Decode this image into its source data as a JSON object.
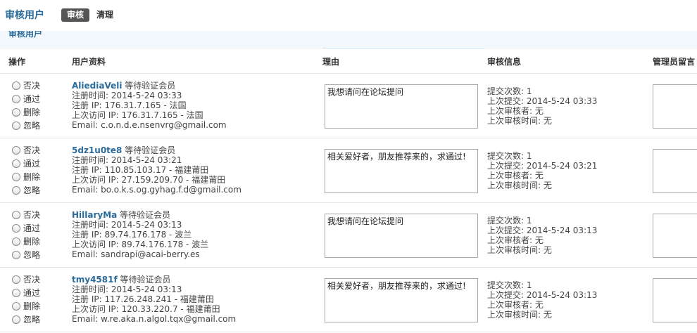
{
  "header": {
    "title": "审核用户",
    "tabs": [
      {
        "label": "审核",
        "active": true
      },
      {
        "label": "清理",
        "active": false
      }
    ]
  },
  "section": {
    "title": "审核用户"
  },
  "columns": {
    "action": "操作",
    "profile": "用户资料",
    "reason": "理由",
    "audit": "审核信息",
    "admin_note": "管理员留言"
  },
  "radio_labels": [
    "否决",
    "通过",
    "删除",
    "忽略"
  ],
  "users": [
    {
      "username": "AliediaVeli",
      "group": "等待验证会员",
      "reg_time": "注册时间: 2014-5-24 03:33",
      "reg_ip": "注册 IP: 176.31.7.165 - 法国",
      "last_ip": "上次访问 IP: 176.31.7.165 - 法国",
      "email": "Email: c.o.n.d.e.nsenvrg@gmail.com",
      "reason": "我想请问在论坛提问",
      "submit_count": "提交次数: 1",
      "last_submit": "上次提交: 2014-5-24 03:33",
      "last_reviewer": "上次审核者: 无",
      "last_review_time": "上次审核时间: 无"
    },
    {
      "username": "5dz1u0te8",
      "group": "等待验证会员",
      "reg_time": "注册时间: 2014-5-24 03:21",
      "reg_ip": "注册 IP: 110.85.103.17 - 福建莆田",
      "last_ip": "上次访问 IP: 27.159.209.70 - 福建莆田",
      "email": "Email: bo.o.k.s.og.gyhag.f.d@gmail.com",
      "reason": "相关爱好者，朋友推荐来的，求通过!",
      "submit_count": "提交次数: 1",
      "last_submit": "上次提交: 2014-5-24 03:21",
      "last_reviewer": "上次审核者: 无",
      "last_review_time": "上次审核时间: 无"
    },
    {
      "username": "HillaryMa",
      "group": "等待验证会员",
      "reg_time": "注册时间: 2014-5-24 03:13",
      "reg_ip": "注册 IP: 89.74.176.178 - 波兰",
      "last_ip": "上次访问 IP: 89.74.176.178 - 波兰",
      "email": "Email: sandrapi@acai-berry.es",
      "reason": "我想请问在论坛提问",
      "submit_count": "提交次数: 1",
      "last_submit": "上次提交: 2014-5-24 03:13",
      "last_reviewer": "上次审核者: 无",
      "last_review_time": "上次审核时间: 无"
    },
    {
      "username": "tmy4581f",
      "group": "等待验证会员",
      "reg_time": "注册时间: 2014-5-24 03:13",
      "reg_ip": "注册 IP: 117.26.248.241 - 福建莆田",
      "last_ip": "上次访问 IP: 120.33.220.7 - 福建莆田",
      "email": "Email: w.re.aka.n.algol.tqx@gmail.com",
      "reason": "相关爱好者，朋友推荐来的，求通过!",
      "submit_count": "提交次数: 1",
      "last_submit": "上次提交: 2014-5-24 03:13",
      "last_reviewer": "上次审核者: 无",
      "last_review_time": "上次审核时间: 无"
    }
  ]
}
